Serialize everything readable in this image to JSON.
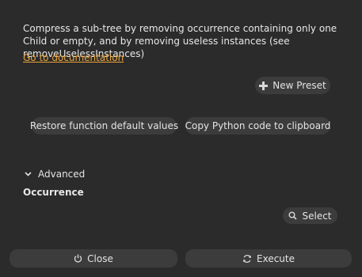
{
  "description": "Compress a sub-tree by removing occurrence containing only one Child or empty, and by removing useless instances (see removeUselessInstances)",
  "doc_link": "Go to documentation",
  "presets": {
    "new_preset": "New Preset"
  },
  "actions": {
    "restore_defaults": "Restore function default values",
    "copy_python": "Copy Python code to clipboard"
  },
  "advanced": {
    "label": "Advanced"
  },
  "parameters": {
    "occurrence_label": "Occurrence",
    "select_label": "Select"
  },
  "footer": {
    "close": "Close",
    "execute": "Execute"
  },
  "colors": {
    "background": "#2b2b2b",
    "button": "#3c3c3c",
    "link": "#e8a33a",
    "text": "#e6e6e6"
  },
  "icons": {
    "new_preset": "plus-icon",
    "select": "search-icon",
    "close": "power-icon",
    "execute": "refresh-icon",
    "advanced": "chevron-down-icon"
  }
}
